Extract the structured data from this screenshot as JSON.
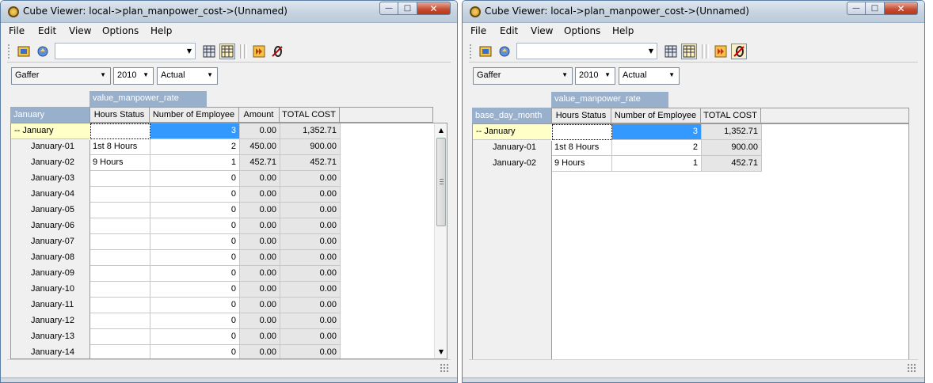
{
  "windows": [
    {
      "title": "Cube Viewer: local->plan_manpower_cost->(Unnamed)",
      "menu": [
        "File",
        "Edit",
        "View",
        "Options",
        "Help"
      ],
      "dims": [
        "Gaffer",
        "2010",
        "Actual"
      ],
      "column_dimension": "value_manpower_rate",
      "row_dimension": "January",
      "columns": [
        "Hours Status",
        "Number of Employee",
        "Amount",
        "TOTAL COST"
      ],
      "rows": [
        {
          "label": "-- January",
          "cells": [
            "",
            "3",
            "0.00",
            "1,352.71"
          ]
        },
        {
          "label": "January-01",
          "cells": [
            "1st 8 Hours",
            "2",
            "450.00",
            "900.00"
          ]
        },
        {
          "label": "January-02",
          "cells": [
            "9 Hours",
            "1",
            "452.71",
            "452.71"
          ]
        },
        {
          "label": "January-03",
          "cells": [
            "",
            "0",
            "0.00",
            "0.00"
          ]
        },
        {
          "label": "January-04",
          "cells": [
            "",
            "0",
            "0.00",
            "0.00"
          ]
        },
        {
          "label": "January-05",
          "cells": [
            "",
            "0",
            "0.00",
            "0.00"
          ]
        },
        {
          "label": "January-06",
          "cells": [
            "",
            "0",
            "0.00",
            "0.00"
          ]
        },
        {
          "label": "January-07",
          "cells": [
            "",
            "0",
            "0.00",
            "0.00"
          ]
        },
        {
          "label": "January-08",
          "cells": [
            "",
            "0",
            "0.00",
            "0.00"
          ]
        },
        {
          "label": "January-09",
          "cells": [
            "",
            "0",
            "0.00",
            "0.00"
          ]
        },
        {
          "label": "January-10",
          "cells": [
            "",
            "0",
            "0.00",
            "0.00"
          ]
        },
        {
          "label": "January-11",
          "cells": [
            "",
            "0",
            "0.00",
            "0.00"
          ]
        },
        {
          "label": "January-12",
          "cells": [
            "",
            "0",
            "0.00",
            "0.00"
          ]
        },
        {
          "label": "January-13",
          "cells": [
            "",
            "0",
            "0.00",
            "0.00"
          ]
        },
        {
          "label": "January-14",
          "cells": [
            "",
            "0",
            "0.00",
            "0.00"
          ]
        }
      ]
    },
    {
      "title": "Cube Viewer: local->plan_manpower_cost->(Unnamed)",
      "menu": [
        "File",
        "Edit",
        "View",
        "Options",
        "Help"
      ],
      "dims": [
        "Gaffer",
        "2010",
        "Actual"
      ],
      "column_dimension": "value_manpower_rate",
      "row_dimension": "base_day_month",
      "columns": [
        "Hours Status",
        "Number of Employee",
        "TOTAL COST"
      ],
      "rows": [
        {
          "label": "-- January",
          "cells": [
            "",
            "3",
            "1,352.71"
          ]
        },
        {
          "label": "January-01",
          "cells": [
            "1st 8 Hours",
            "2",
            "900.00"
          ]
        },
        {
          "label": "January-02",
          "cells": [
            "9 Hours",
            "1",
            "452.71"
          ]
        }
      ]
    }
  ],
  "icons": {
    "app": "cube-app-icon",
    "toolbar": [
      "recalculate-icon",
      "refresh-icon",
      "view-grid-icon",
      "view-sheet-icon",
      "forward-icon",
      "zero-suppress-icon"
    ]
  }
}
